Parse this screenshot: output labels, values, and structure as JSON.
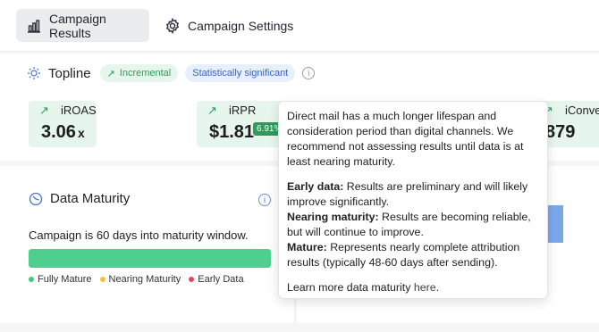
{
  "tabs": [
    {
      "label": "Campaign Results",
      "icon": "bar-chart-icon",
      "active": true
    },
    {
      "label": "Campaign Settings",
      "icon": "gear-icon",
      "active": false
    }
  ],
  "topline": {
    "title": "Topline",
    "pills": [
      {
        "label": "Incremental",
        "color": "#2e9b5b"
      },
      {
        "label": "Statistically significant",
        "color": "#3a63c9"
      }
    ]
  },
  "metrics": [
    {
      "label": "iROAS",
      "value": "3.06",
      "suffix": "x"
    },
    {
      "label": "iRPR",
      "value": "$1.81",
      "badge": "6.91%"
    },
    {
      "label": "iConve",
      "value": "879"
    }
  ],
  "maturity": {
    "title": "Data Maturity",
    "status_text": "Campaign is 60 days into maturity window.",
    "progress": 1.0,
    "legend": [
      {
        "label": "Fully Mature",
        "color": "#3ecb7f"
      },
      {
        "label": "Nearing Maturity",
        "color": "#f3c23c"
      },
      {
        "label": "Early Data",
        "color": "#e5445f"
      }
    ]
  },
  "tooltip": {
    "intro": "Direct mail has a much longer lifespan and consideration period than digital channels. We recommend not assessing results until data is at least nearing maturity.",
    "definitions": [
      {
        "term": "Early data:",
        "text": " Results are preliminary and will likely improve significantly."
      },
      {
        "term": "Nearing maturity:",
        "text": " Results are becoming reliable, but will continue to improve."
      },
      {
        "term": "Mature:",
        "text": " Represents nearly complete attribution results (typically 48-60 days after sending)."
      }
    ],
    "footer_text": "Learn more data maturity ",
    "footer_link": "here",
    "footer_end": "."
  }
}
